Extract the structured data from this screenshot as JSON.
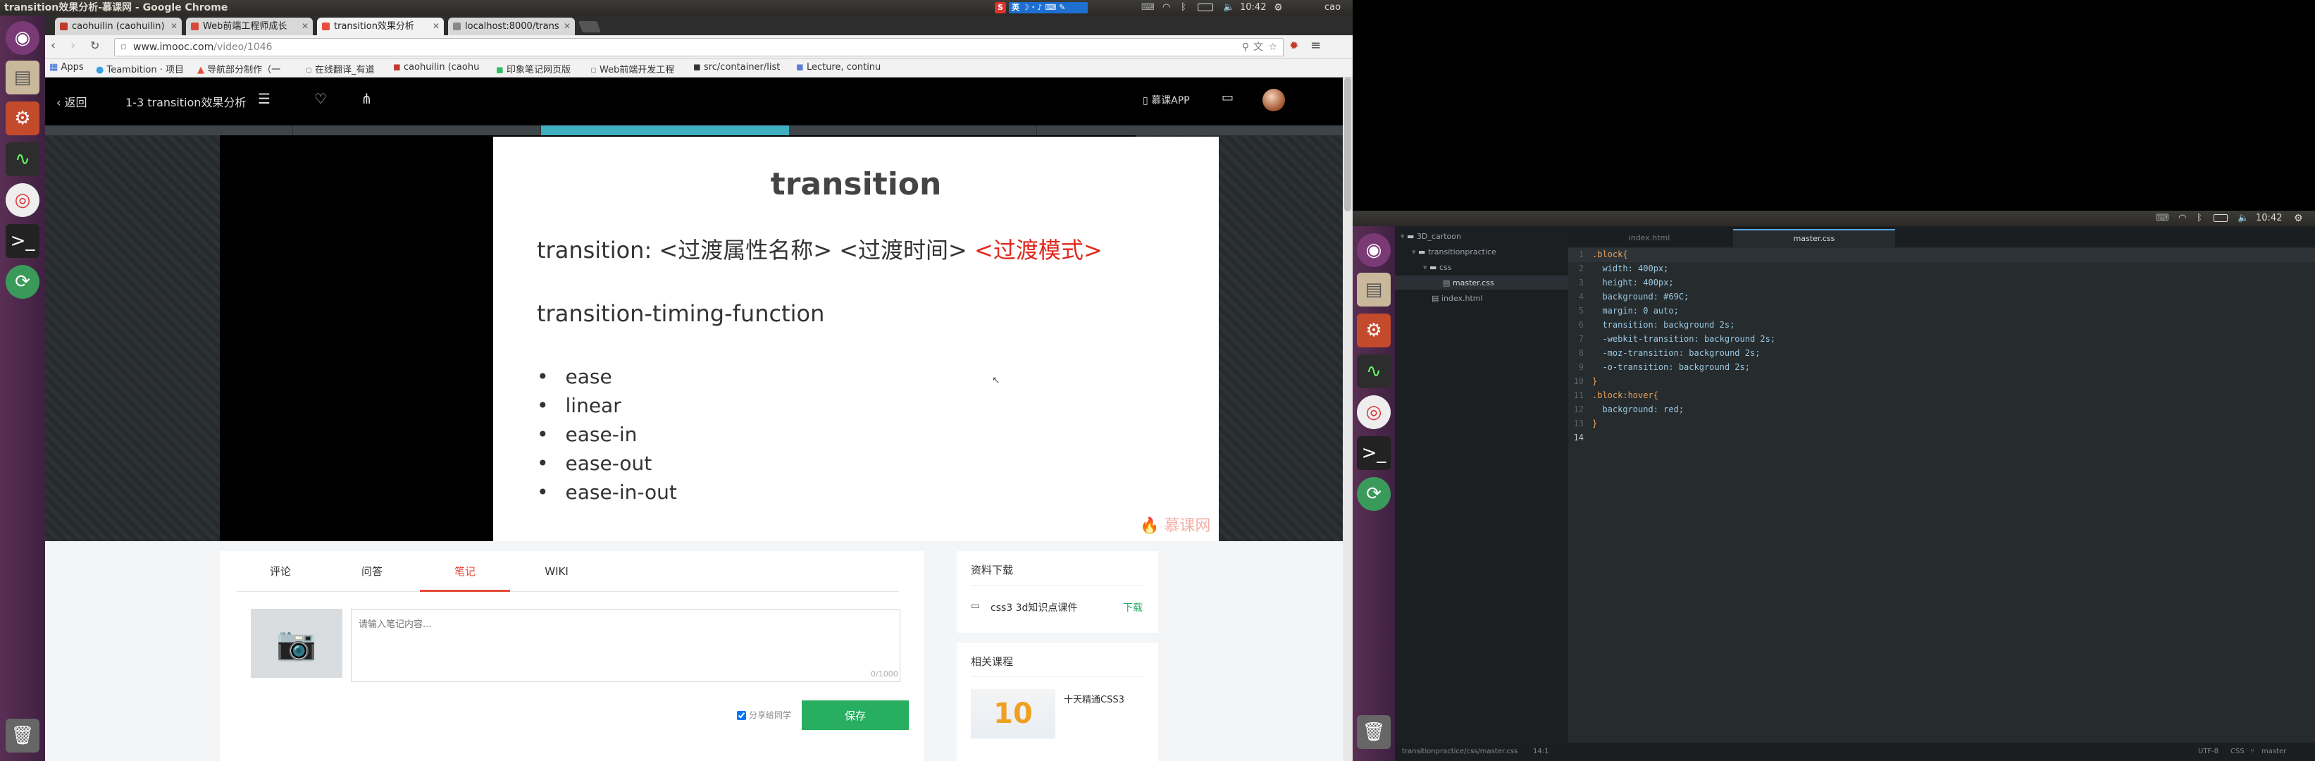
{
  "topbar1": {
    "title": "transition效果分析-慕课网 - Google Chrome",
    "time": "10:42",
    "user": "cao",
    "ime": "英"
  },
  "tabs": [
    {
      "label": "caohuilin (caohuilin)",
      "active": false,
      "color": "#c0392b"
    },
    {
      "label": "Web前端工程师成长",
      "active": false,
      "color": "#d64a3b"
    },
    {
      "label": "transition效果分析",
      "active": true,
      "color": "#e74c3c"
    },
    {
      "label": "localhost:8000/trans",
      "active": false,
      "color": "#666666"
    }
  ],
  "omnibox": {
    "url_host": "www.imooc.com",
    "url_path": "/video/1046"
  },
  "bookmarks": [
    {
      "label": "Apps",
      "icon": "apps-grid-icon"
    },
    {
      "label": "Teambition · 项目",
      "icon": "teambition-icon"
    },
    {
      "label": "导航部分制作（一",
      "icon": "imooc-icon"
    },
    {
      "label": "在线翻译_有道",
      "icon": "page-icon"
    },
    {
      "label": "caohuilin (caohu",
      "icon": "github-icon"
    },
    {
      "label": "印象笔记网页版",
      "icon": "evernote-icon"
    },
    {
      "label": "Web前端开发工程",
      "icon": "page-icon"
    },
    {
      "label": "src/container/list",
      "icon": "github-icon"
    },
    {
      "label": "Lecture, continu",
      "icon": "lecture-icon"
    }
  ],
  "video_header": {
    "back_label": "返回",
    "course_title": "1-3 transition效果分析",
    "app_label": "慕课APP"
  },
  "slide": {
    "title": "transition",
    "syntax_prefix": "transition: <过渡属性名称> <过渡时间>",
    "syntax_highlight": "<过渡模式>",
    "subtitle": "transition-timing-function",
    "bullets": [
      "ease",
      "linear",
      "ease-in",
      "ease-out",
      "ease-in-out"
    ],
    "watermark": "慕课网",
    "highlight_color": "#e0281c"
  },
  "notes_panel": {
    "tabs": [
      {
        "label": "评论",
        "active": false
      },
      {
        "label": "问答",
        "active": false
      },
      {
        "label": "笔记",
        "active": true
      },
      {
        "label": "WIKI",
        "active": false
      }
    ],
    "placeholder": "请输入笔记内容...",
    "counter": "0/1000",
    "share_label": "分享给同学",
    "save_label": "保存",
    "accent": "#e74c3c",
    "save_color": "#27ae60"
  },
  "downloads": {
    "heading": "资料下载",
    "file_name": "css3 3d知识点课件",
    "download_label": "下载"
  },
  "related": {
    "heading": "相关课程",
    "course_name": "十天精通CSS3",
    "thumb_text": "10"
  },
  "topbar2": {
    "time": "10:42"
  },
  "editor": {
    "tree": [
      {
        "label": "3D_cartoon",
        "depth": 0,
        "type": "folder",
        "open": true
      },
      {
        "label": "transitionpractice",
        "depth": 1,
        "type": "folder",
        "open": true
      },
      {
        "label": "css",
        "depth": 2,
        "type": "folder",
        "open": true
      },
      {
        "label": "master.css",
        "depth": 3,
        "type": "file",
        "selected": true
      },
      {
        "label": "index.html",
        "depth": 2,
        "type": "file",
        "selected": false
      }
    ],
    "tabs": [
      {
        "label": "index.html",
        "active": false
      },
      {
        "label": "master.css",
        "active": true
      }
    ],
    "code_lines": [
      ".block{",
      "  width: 400px;",
      "  height: 400px;",
      "  background: #69C;",
      "  margin: 0 auto;",
      "  transition: background 2s;",
      "  -webkit-transition: background 2s;",
      "  -moz-transition: background 2s;",
      "  -o-transition: background 2s;",
      "}",
      ".block:hover{",
      "  background: red;",
      "}",
      ""
    ],
    "status_path": "transitionpractice/css/master.css",
    "status_pos": "14:1",
    "status_encoding": "UTF-8",
    "status_lang": "CSS",
    "status_branch": "master"
  }
}
